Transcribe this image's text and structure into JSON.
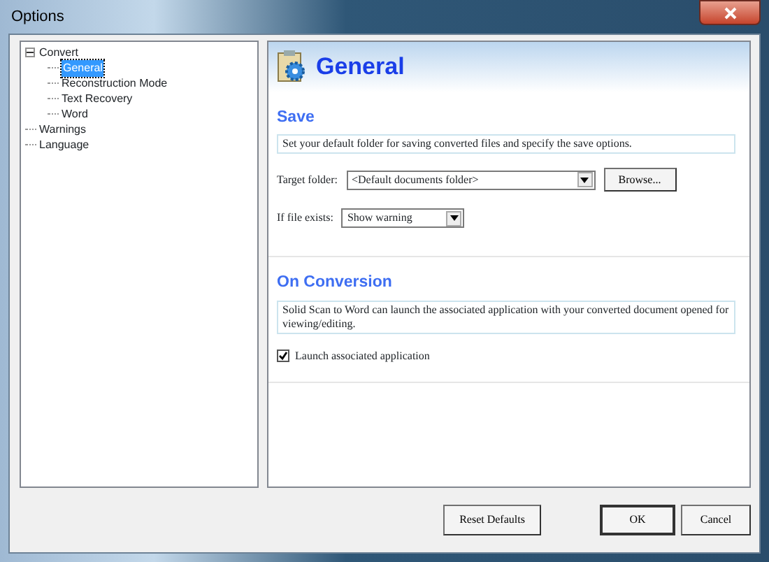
{
  "window": {
    "title": "Options"
  },
  "tree": [
    {
      "label": "Convert",
      "expanded": true,
      "selected": false,
      "children": [
        {
          "label": "General",
          "selected": true
        },
        {
          "label": "Reconstruction Mode",
          "selected": false
        },
        {
          "label": "Text Recovery",
          "selected": false
        },
        {
          "label": "Word",
          "selected": false
        }
      ]
    },
    {
      "label": "Warnings",
      "selected": false
    },
    {
      "label": "Language",
      "selected": false
    }
  ],
  "page": {
    "title": "General",
    "sections": [
      {
        "heading": "Save",
        "description": "Set your default folder for saving converted files and specify the save options.",
        "fields": [
          {
            "kind": "combo",
            "label": "Target folder:",
            "value": "<Default documents folder>",
            "button": "Browse..."
          },
          {
            "kind": "combo",
            "label": "If file exists:",
            "value": "Show warning"
          }
        ]
      },
      {
        "heading": "On Conversion",
        "description": "Solid Scan to Word can launch the associated application with your converted document opened for viewing/editing.",
        "fields": [
          {
            "kind": "checkbox",
            "label": "Launch associated application",
            "checked": true
          }
        ]
      }
    ]
  },
  "buttons": [
    {
      "label": "Reset Defaults"
    },
    {
      "label": "OK"
    },
    {
      "label": "Cancel"
    }
  ]
}
